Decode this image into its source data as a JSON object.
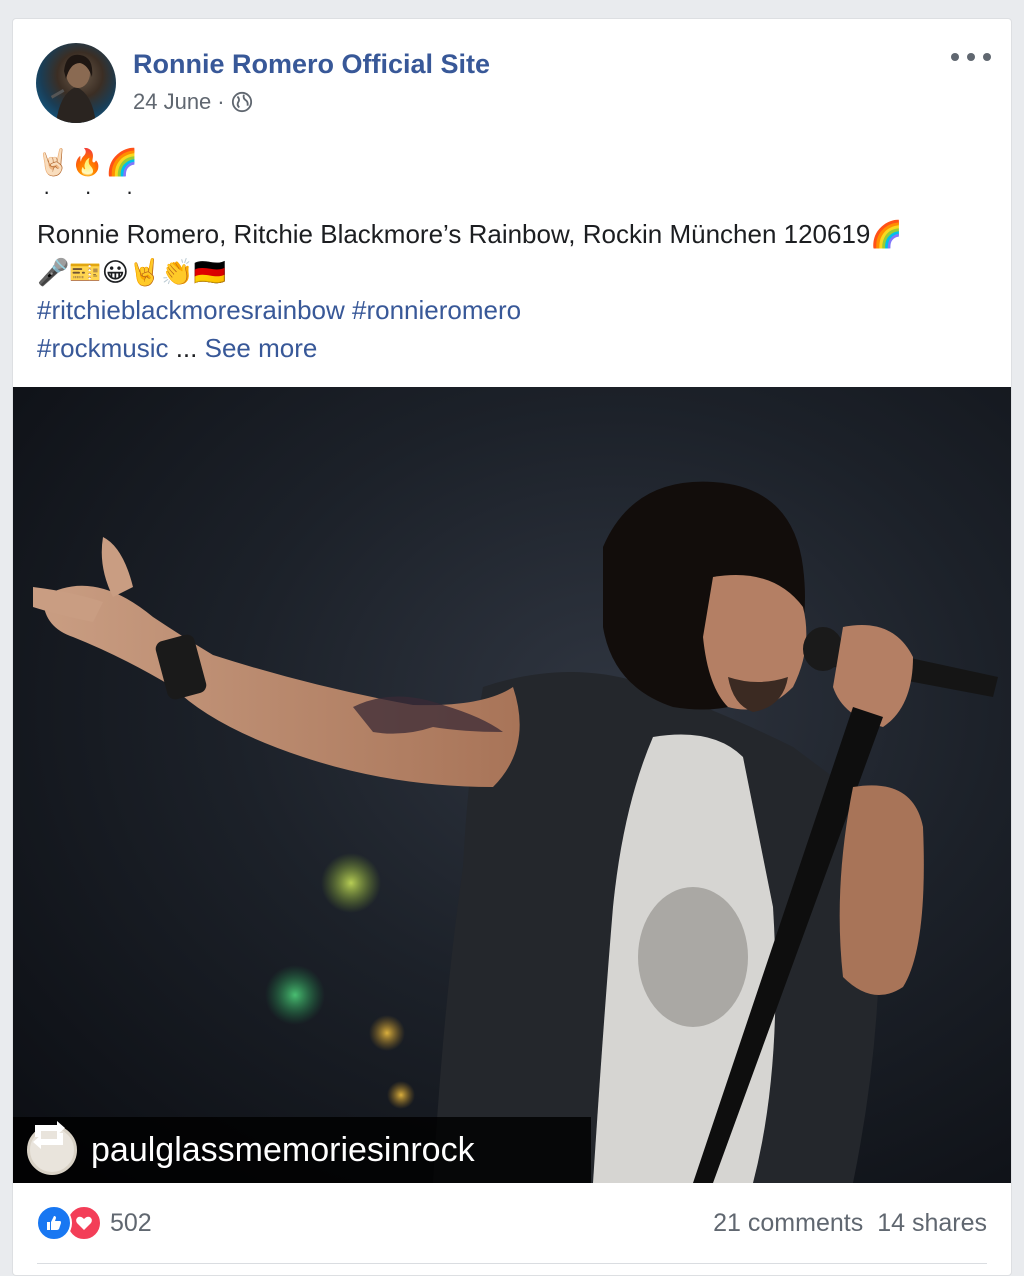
{
  "post": {
    "page_name": "Ronnie Romero Official Site",
    "date": "24 June",
    "separator": "·",
    "visibility_icon": "globe-icon",
    "emoji_line": "🤘🏻🔥🌈",
    "dots": "· · ·",
    "caption": "Ronnie Romero, Ritchie Blackmore’s Rainbow, Rockin München 120619🌈",
    "caption_emojis": "🎤🎫😀🤘👏🇩🇪",
    "hashtags_line1": "#ritchieblackmoresrainbow #ronnieromero",
    "hashtag_line2": "#rockmusic",
    "ellipsis": " ... ",
    "see_more": "See more"
  },
  "photo": {
    "repost_credit": "paulglassmemoriesinrock"
  },
  "footer": {
    "reaction_count": "502",
    "comments": "21 comments",
    "shares": "14 shares"
  },
  "colors": {
    "link": "#385898",
    "meta": "#606770",
    "like": "#1877f2",
    "love": "#f33e58"
  }
}
